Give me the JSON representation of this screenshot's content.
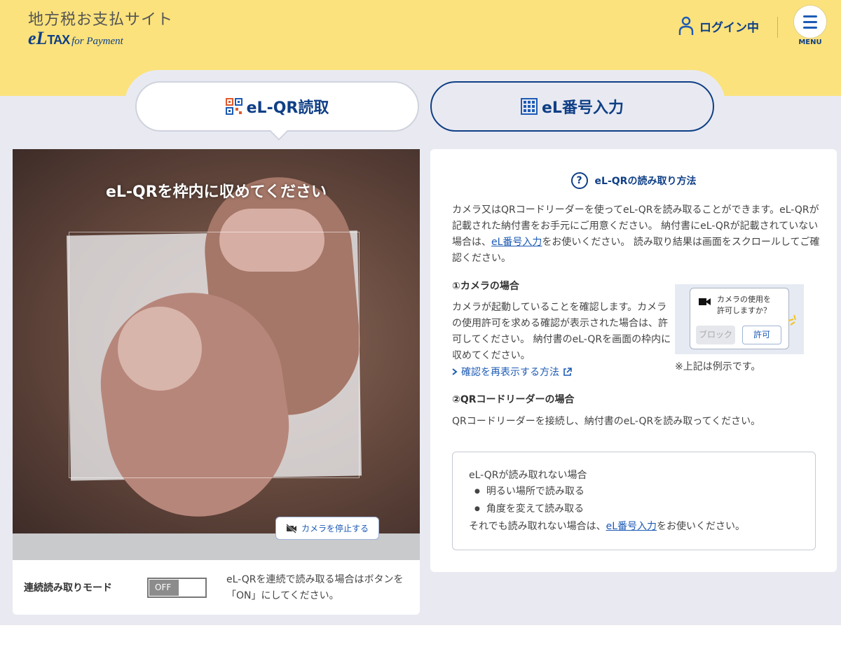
{
  "header": {
    "site_title": "地方税お支払サイト",
    "logo_e": "eL",
    "logo_tax": "TAX",
    "logo_for_payment": "for Payment",
    "login_label": "ログイン中",
    "menu_label": "MENU"
  },
  "tabs": [
    {
      "label": "eL-QR読取",
      "active": true
    },
    {
      "label": "eL番号入力",
      "active": false
    }
  ],
  "camera": {
    "message": "eL-QRを枠内に収めてください",
    "stop_button": "カメラを停止する"
  },
  "continuous_mode": {
    "label": "連続読み取りモード",
    "toggle_value": "OFF",
    "description": "eL-QRを連続で読み取る場合はボタンを「ON」にしてください。"
  },
  "instructions": {
    "title": "eL-QRの読み取り方法",
    "intro_before_link": "カメラ又はQRコードリーダーを使ってeL-QRを読み取ることができます。eL-QRが記載された納付書をお手元にご用意ください。 納付書にeL-QRが記載されていない場合は、",
    "intro_link": "eL番号入力",
    "intro_after_link": "をお使いください。 読み取り結果は画面をスクロールしてご確認ください。",
    "camera_heading": "①カメラの場合",
    "camera_text": "カメラが起動していることを確認します。カメラの使用許可を求める確認が表示された場合は、許可してください。 納付書のeL-QRを画面の枠内に収めてください。",
    "redisplay_link": "確認を再表示する方法",
    "example_dialog_text_1": "カメラの使用を",
    "example_dialog_text_2": "許可しますか？",
    "example_block": "ブロック",
    "example_allow": "許可",
    "example_note": "※上記は例示です。",
    "reader_heading": "②QRコードリーダーの場合",
    "reader_text": "QRコードリーダーを接続し、納付書のeL-QRを読み取ってください。",
    "tips_title": "eL-QRが読み取れない場合",
    "tips_items": [
      "明るい場所で読み取る",
      "角度を変えて読み取る"
    ],
    "tips_footer_before": "それでも読み取れない場合は、",
    "tips_footer_link": "eL番号入力",
    "tips_footer_after": "をお使いください。"
  },
  "colors": {
    "header_bg": "#fbe27c",
    "body_bg": "#e9eaf1",
    "brand_navy": "#0f3f86",
    "link_blue": "#1d5bb5"
  }
}
